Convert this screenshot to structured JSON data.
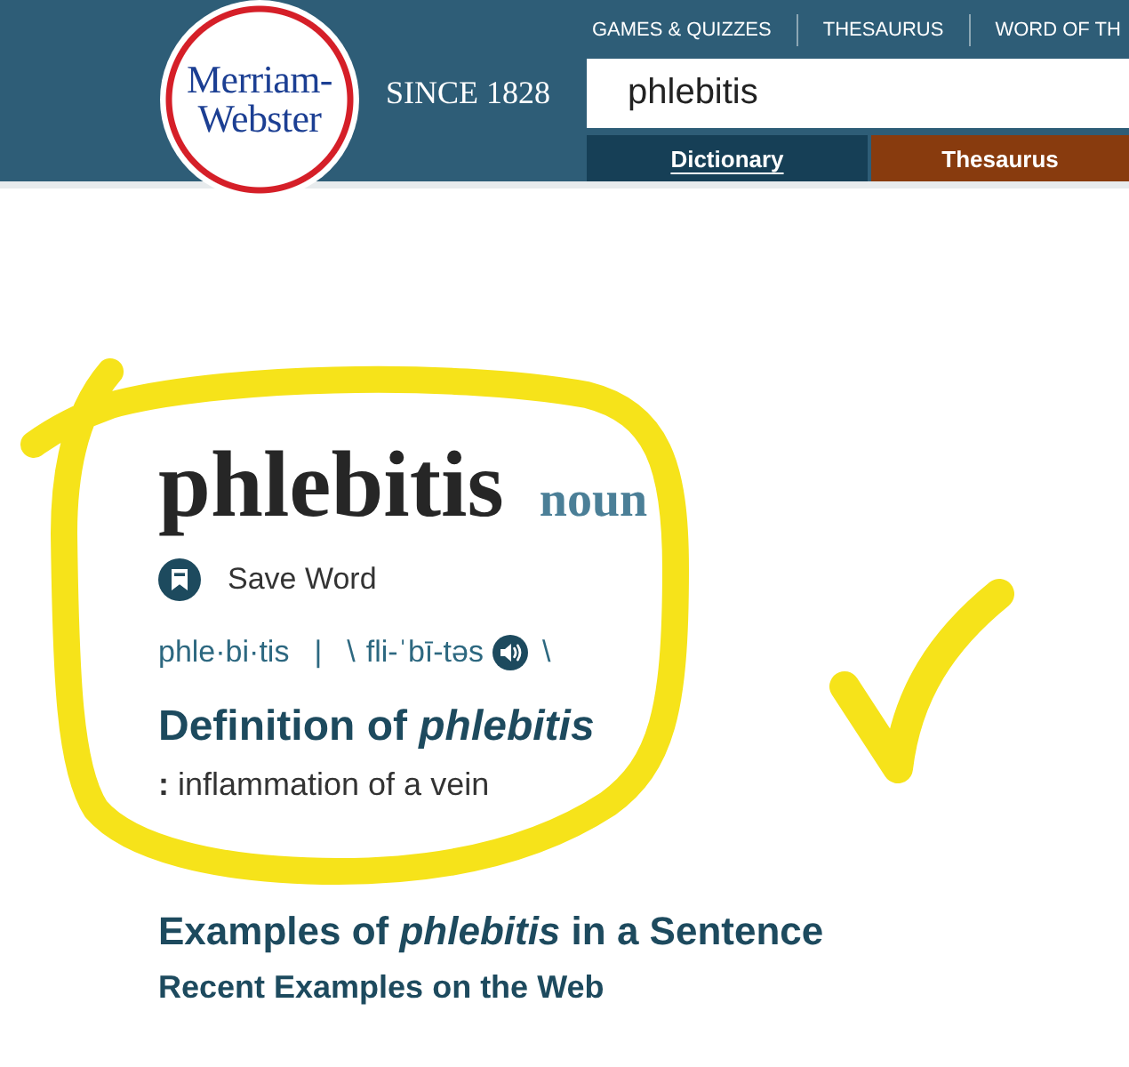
{
  "header": {
    "logo": "Merriam-Webster",
    "tagline": "SINCE 1828",
    "nav": [
      "GAMES & QUIZZES",
      "THESAURUS",
      "WORD OF TH"
    ],
    "search": {
      "value": "phlebitis"
    },
    "tabs": [
      {
        "label": "Dictionary",
        "selected": true,
        "color": "#163f56"
      },
      {
        "label": "Thesaurus",
        "selected": false,
        "color": "#883b0e"
      }
    ]
  },
  "entry": {
    "headword": "phlebitis",
    "part_of_speech": "noun",
    "save_label": "Save Word",
    "syllables": "phle·bi·tis",
    "separator": "|",
    "pron_open": "\\",
    "respelling": "fli-ˈbī-təs",
    "pron_close": "\\",
    "definition_heading": "Definition of *phlebitis*",
    "definition": "**:** inflammation of a vein"
  },
  "examples": {
    "heading": "Examples of *phlebitis* in a Sentence",
    "subheading": "Recent Examples on the Web"
  }
}
